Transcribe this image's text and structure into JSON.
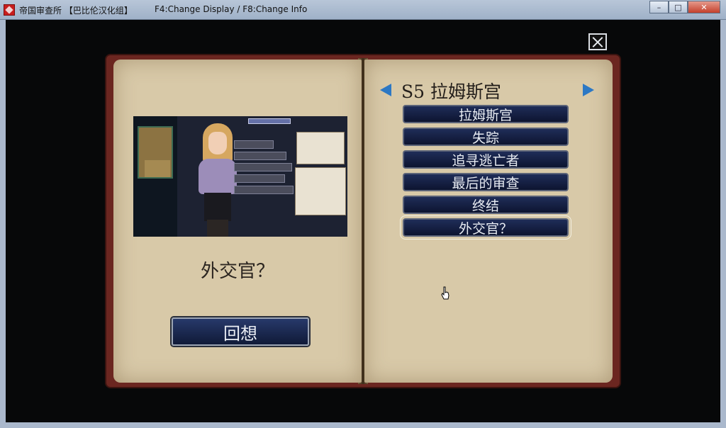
{
  "window": {
    "title": "帝国审查所 【巴比伦汉化组】",
    "hint": "F4:Change Display / F8:Change Info",
    "buttons": {
      "minimize": "–",
      "maximize": "□",
      "close": "✕"
    }
  },
  "left_page": {
    "scene_name": "外交官？",
    "recall_label": "回想"
  },
  "right_page": {
    "chapter_title": "S5 拉姆斯宫",
    "items": [
      "拉姆斯宫",
      "失踪",
      "追寻逃亡者",
      "最后的审查",
      "终结",
      "外交官？"
    ],
    "selected_index": 5
  },
  "icons": {
    "close": "close-x-icon",
    "prev": "arrow-left-icon",
    "next": "arrow-right-icon",
    "cursor": "hand-cursor-icon"
  }
}
